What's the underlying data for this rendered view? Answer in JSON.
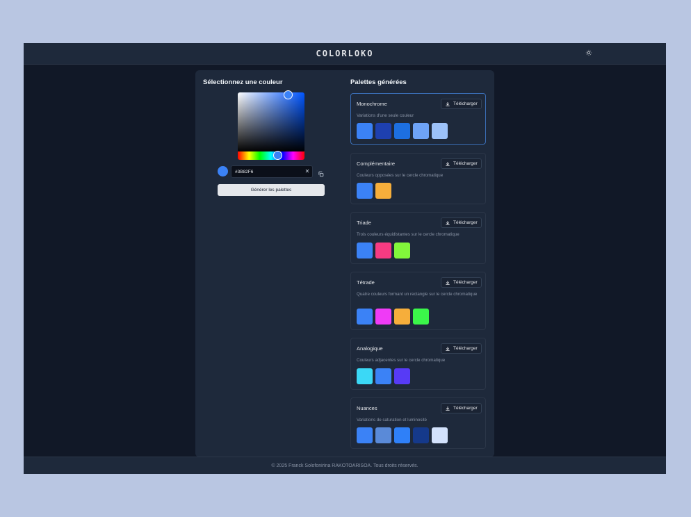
{
  "header": {
    "logo": "COLORLOKO",
    "theme_icon": "sun-icon"
  },
  "picker": {
    "title": "Sélectionnez une couleur",
    "hex_value": "#3B82F6",
    "selected_color": "#3b82f6",
    "clear_icon": "close-icon",
    "copy_icon": "copy-icon",
    "generate_label": "Générer les palettes"
  },
  "palettes": {
    "title": "Palettes générées",
    "download_label": "Télécharger",
    "download_icon": "download-icon",
    "items": [
      {
        "name": "Monochrome",
        "description": "Variations d'une seule couleur",
        "colors": [
          "#3b82f6",
          "#1e40af",
          "#1d6fe0",
          "#6ea3f7",
          "#9dc2f9"
        ]
      },
      {
        "name": "Complémentaire",
        "description": "Couleurs opposées sur le cercle chromatique",
        "colors": [
          "#3b82f6",
          "#f6ae3b"
        ]
      },
      {
        "name": "Triade",
        "description": "Trois couleurs équidistantes sur le cercle chromatique",
        "colors": [
          "#3b82f6",
          "#f63b82",
          "#82f63b"
        ]
      },
      {
        "name": "Tétrade",
        "description": "Quatre couleurs formant un rectangle sur le cercle chromatique",
        "colors": [
          "#3b82f6",
          "#ef3bf6",
          "#f6ae3b",
          "#3bf64a"
        ]
      },
      {
        "name": "Analogique",
        "description": "Couleurs adjacentes sur le cercle chromatique",
        "colors": [
          "#3bd8f6",
          "#3b82f6",
          "#573bf6"
        ]
      },
      {
        "name": "Nuances",
        "description": "Variations de saturation et luminosité",
        "colors": [
          "#3b82f6",
          "#5a8ad8",
          "#2f80f8",
          "#15398a",
          "#d3e2fc"
        ]
      }
    ]
  },
  "footer": {
    "text": "© 2025 Franck Solofonirina RAKOTOARISOA. Tous droits réservés."
  }
}
